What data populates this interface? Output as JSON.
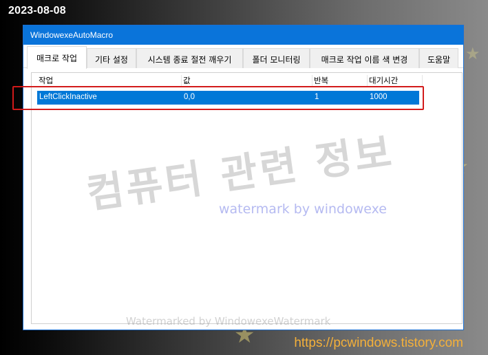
{
  "date_stamp": "2023-08-08",
  "window": {
    "title": "WindowexeAutoMacro",
    "tabs": [
      {
        "label": "매크로 작업",
        "active": true
      },
      {
        "label": "기타 설정",
        "active": false
      },
      {
        "label": "시스템 종료 절전 깨우기",
        "active": false
      },
      {
        "label": "폴더 모니터링",
        "active": false
      },
      {
        "label": "매크로 작업 이름 색 변경",
        "active": false
      },
      {
        "label": "도움말",
        "active": false
      }
    ],
    "list": {
      "columns": [
        "작업",
        "값",
        "반복",
        "대기시간"
      ],
      "rows": [
        {
          "task": "LeftClickInactive",
          "value": "0,0",
          "repeat": "1",
          "wait": "1000",
          "selected": true
        }
      ]
    }
  },
  "watermarks": {
    "korean": "컴퓨터 관련 정보",
    "english": "watermark by windowexe",
    "bottom": "Watermarked by WindowexeWatermark"
  },
  "site_url": "https://pcwindows.tistory.com",
  "colors": {
    "titlebar": "#0a74da",
    "selection": "#0078d7",
    "highlight_box": "#d21a1a",
    "url": "#f4b03a"
  }
}
